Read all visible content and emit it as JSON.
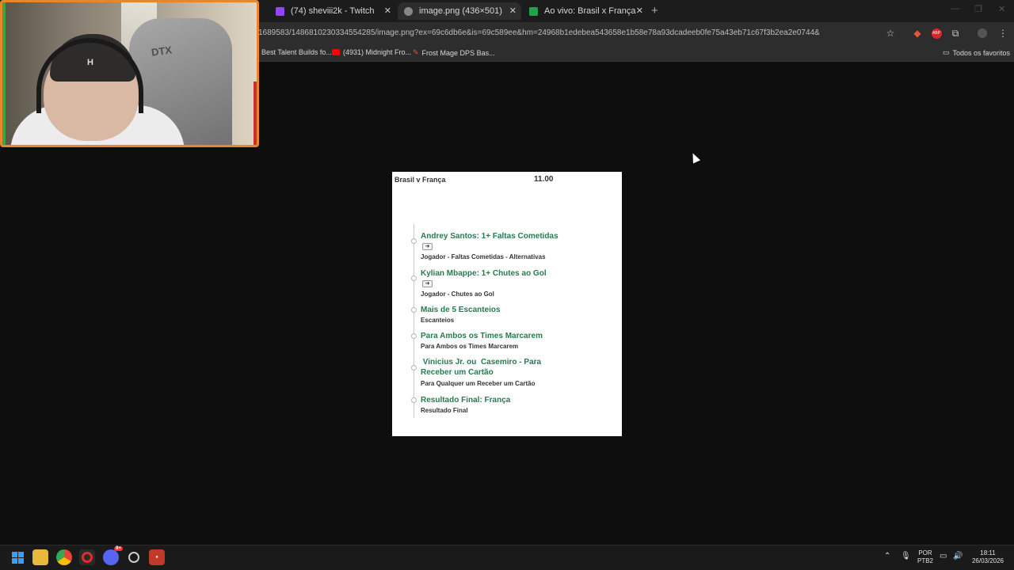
{
  "browser": {
    "tabs": [
      {
        "title": "(74) sheviii2k - Twitch",
        "icon_color": "#9146ff"
      },
      {
        "title": "image.png (436×501)",
        "icon_color": "#888888"
      },
      {
        "title": "Ao vivo: Brasil x França | Amisto",
        "icon_color": "#1fa24a"
      }
    ],
    "new_tab_symbol": "+",
    "url": "1689583/1486810230334554285/image.png?ex=69c6db6e&is=69c589ee&hm=24968b1edebea543658e1b58e78a93dcadeeb0fe75a43eb71c67f3b2ea2e0744&",
    "bookmarks": [
      {
        "label": "Best Talent Builds fo..."
      },
      {
        "label": "(4931) Midnight Fro..."
      },
      {
        "label": "Frost Mage DPS Bas..."
      }
    ],
    "all_bookmarks_label": "Todos os favoritos",
    "colors": {
      "accent_youtube": "#ff0000",
      "accent_twitch": "#9146ff"
    }
  },
  "webcam": {
    "chair_brand": "DTX",
    "cap_logo": "H",
    "border_color": "#e8862a"
  },
  "bet_card": {
    "match": "Brasil v França",
    "odds": "11.00",
    "boost_symbol": "➜",
    "selections": [
      {
        "title": "Andrey Santos: 1+ Faltas Cometidas",
        "sub_bold": "Jogador",
        "sub_rest": " - Faltas Cometidas - Alternativas",
        "boost": true
      },
      {
        "title": "Kylian Mbappe: 1+ Chutes ao Gol",
        "sub_bold": "Jogador",
        "sub_rest": " - Chutes ao Gol",
        "boost": true
      },
      {
        "title": "Mais de 5 Escanteios",
        "sub_bold": "Escanteios",
        "sub_rest": "",
        "boost": false
      },
      {
        "title": "Para Ambos os Times Marcarem",
        "sub_bold": "Para Ambos os Times Marcarem",
        "sub_rest": "",
        "boost": false
      },
      {
        "title": " Vinicius Jr. ou  Casemiro - Para Receber um Cartão",
        "sub_bold": "Para Qualquer um Receber um Cartão",
        "sub_rest": "",
        "boost": false
      },
      {
        "title": "Resultado Final: França",
        "sub_bold": "Resultado Final",
        "sub_rest": "",
        "boost": false
      }
    ],
    "title_color": "#287a4f"
  },
  "taskbar": {
    "language": "POR",
    "layout": "PTB2",
    "time": "18:11",
    "date": "26/03/2026",
    "discord_badge": "9+"
  }
}
